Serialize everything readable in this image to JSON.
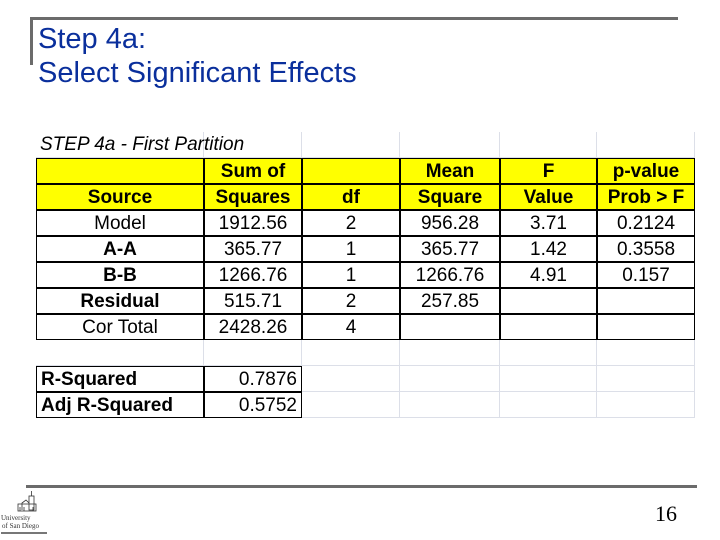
{
  "slide": {
    "title_line1": "Step 4a:",
    "title_line2": "Select Significant Effects",
    "page_number": "16",
    "logo_text": [
      "University",
      "of San Diego"
    ]
  },
  "sheet": {
    "title": "STEP 4a - First Partition",
    "header_row1": [
      "",
      "Sum of",
      "",
      "Mean",
      "F",
      "p-value"
    ],
    "header_row2": [
      "Source",
      "Squares",
      "df",
      "Square",
      "Value",
      "Prob > F"
    ],
    "rows": [
      {
        "source": "Model",
        "ss": "1912.56",
        "df": "2",
        "ms": "956.28",
        "f": "3.71",
        "p": "0.2124"
      },
      {
        "source": "A-A",
        "ss": "365.77",
        "df": "1",
        "ms": "365.77",
        "f": "1.42",
        "p": "0.3558"
      },
      {
        "source": "B-B",
        "ss": "1266.76",
        "df": "1",
        "ms": "1266.76",
        "f": "4.91",
        "p": "0.157"
      },
      {
        "source": "Residual",
        "ss": "515.71",
        "df": "2",
        "ms": "257.85",
        "f": "",
        "p": ""
      },
      {
        "source": "Cor Total",
        "ss": "2428.26",
        "df": "4",
        "ms": "",
        "f": "",
        "p": ""
      }
    ],
    "stats": [
      {
        "label": "R-Squared",
        "value": "0.7876"
      },
      {
        "label": "Adj R-Squared",
        "value": "0.5752"
      }
    ],
    "header_color": "#ffff00"
  }
}
